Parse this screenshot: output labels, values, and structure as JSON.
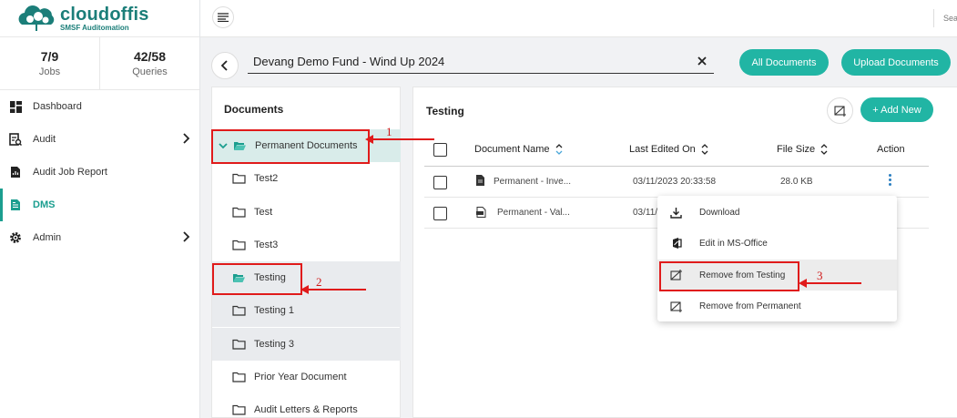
{
  "brand": {
    "name": "cloudoffis",
    "tagline": "SMSF Auditomation",
    "color": "#1b7e79"
  },
  "stats": [
    {
      "value": "7/9",
      "label": "Jobs"
    },
    {
      "value": "42/58",
      "label": "Queries"
    }
  ],
  "nav": [
    {
      "label": "Dashboard",
      "icon": "dashboard-icon"
    },
    {
      "label": "Audit",
      "icon": "audit-icon",
      "has_children": true
    },
    {
      "label": "Audit Job Report",
      "icon": "report-icon"
    },
    {
      "label": "DMS",
      "icon": "document-icon",
      "active": true
    },
    {
      "label": "Admin",
      "icon": "gear-icon",
      "has_children": true
    }
  ],
  "topbar": {
    "search_text": "Sea"
  },
  "fund": {
    "title": "Devang Demo Fund - Wind Up 2024"
  },
  "header_buttons": {
    "all_documents": "All Documents",
    "upload_documents": "Upload Documents"
  },
  "documents": {
    "title": "Documents",
    "folders": [
      {
        "label": "Permanent Documents",
        "open": true
      },
      {
        "label": "Test2"
      },
      {
        "label": "Test"
      },
      {
        "label": "Test3"
      },
      {
        "label": "Testing",
        "open": true
      },
      {
        "label": "Testing 1"
      },
      {
        "label": "Testing 3"
      },
      {
        "label": "Prior Year Document"
      },
      {
        "label": "Audit Letters & Reports"
      }
    ]
  },
  "files": {
    "title": "Testing",
    "add_label": "+ Add New",
    "columns": {
      "name": "Document Name",
      "edited": "Last Edited On",
      "size": "File Size",
      "action": "Action"
    },
    "rows": [
      {
        "name": "Permanent - Inve...",
        "edited": "03/11/2023 20:33:58",
        "size": "28.0 KB"
      },
      {
        "name": "Permanent - Val...",
        "edited": "03/11/2"
      }
    ]
  },
  "context_menu": [
    {
      "label": "Download",
      "icon": "download-icon"
    },
    {
      "label": "Edit in MS-Office",
      "icon": "office-icon"
    },
    {
      "label": "Remove from Testing",
      "icon": "remove-folder-icon"
    },
    {
      "label": "Remove from Permanent",
      "icon": "remove-folder-icon"
    }
  ],
  "annotations": [
    "1",
    "2",
    "3"
  ],
  "colors": {
    "accent": "#21b5a4",
    "annotation": "#e01b1b"
  }
}
